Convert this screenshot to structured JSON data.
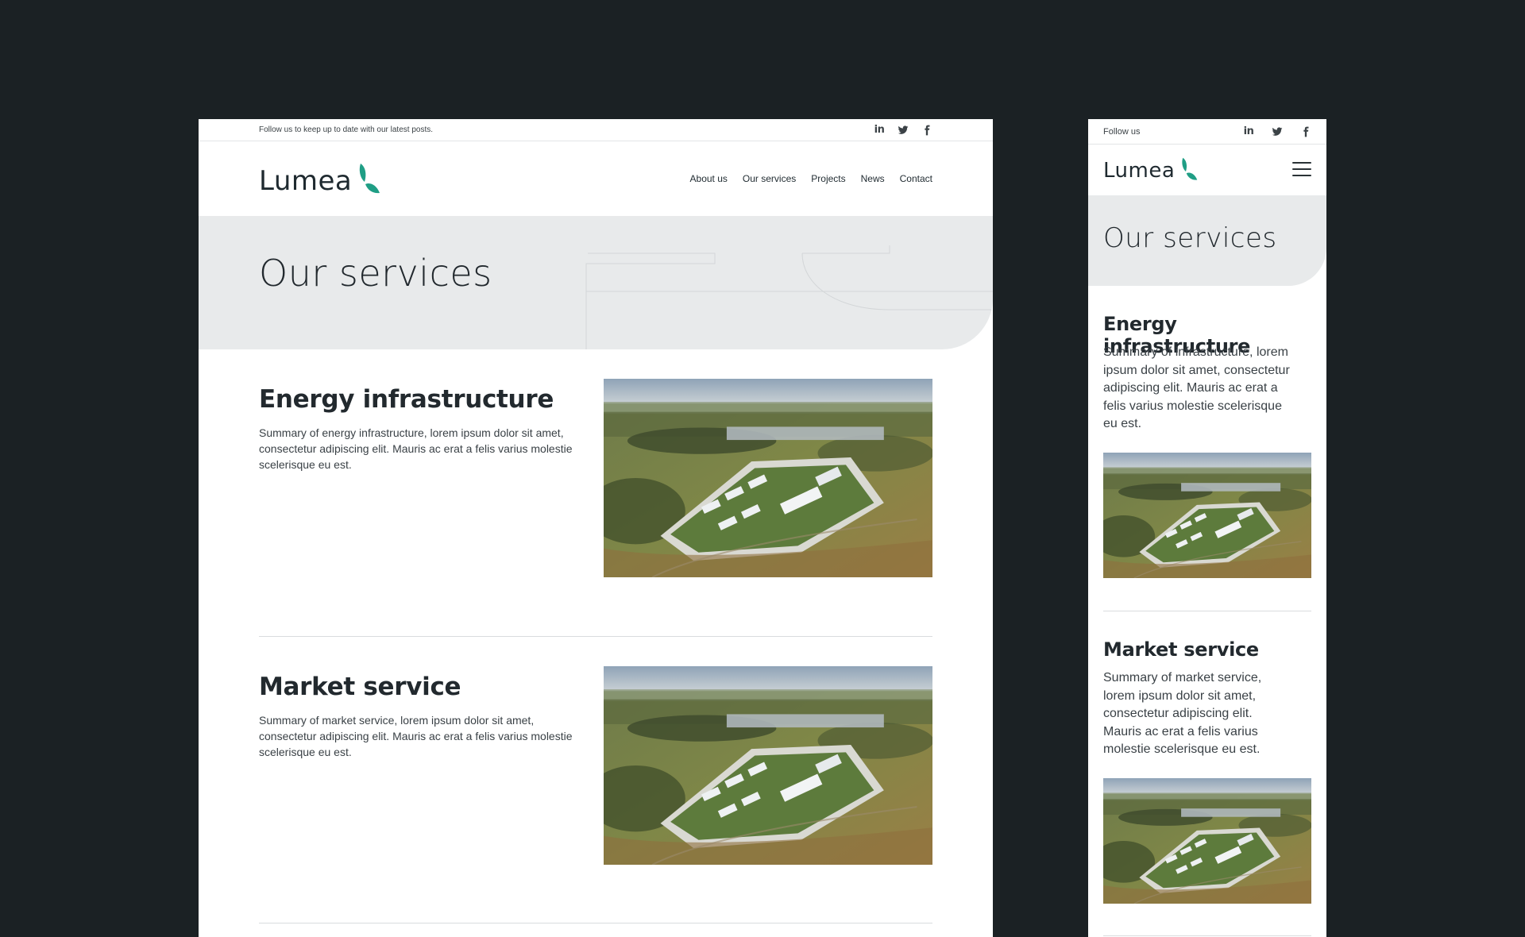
{
  "brand": {
    "name": "Lumea",
    "accent": "#1f9e85",
    "dark": "#1b2124",
    "hero_bg": "#e8eaeb"
  },
  "desktop": {
    "topbar": {
      "text": "Follow us to keep up to date with our latest posts.",
      "socials": [
        "linkedin-icon",
        "twitter-icon",
        "facebook-icon"
      ]
    },
    "nav": [
      "About us",
      "Our services",
      "Projects",
      "News",
      "Contact"
    ],
    "hero": {
      "title": "Our services"
    },
    "services": [
      {
        "title": "Energy infrastructure",
        "summary": "Summary of energy infrastructure, lorem ipsum dolor sit amet, consectetur adipiscing elit. Mauris ac erat a felis varius molestie scelerisque eu est."
      },
      {
        "title": "Market service",
        "summary": "Summary of market service, lorem ipsum dolor sit amet, consectetur adipiscing elit. Mauris ac erat a felis varius molestie scelerisque eu est."
      }
    ]
  },
  "mobile": {
    "topbar": {
      "text": "Follow us",
      "socials": [
        "linkedin-icon",
        "twitter-icon",
        "facebook-icon"
      ]
    },
    "menu_icon": "hamburger-menu-icon",
    "hero": {
      "title": "Our services"
    },
    "services": [
      {
        "title": "Energy infrastructure",
        "summary": "Summary of infrastructure, lorem ipsum dolor sit amet, consectetur adipiscing elit. Mauris ac erat a felis varius molestie scelerisque eu est."
      },
      {
        "title": "Market service",
        "summary": "Summary of market service, lorem ipsum dolor sit amet, consectetur adipiscing elit. Mauris ac erat a felis varius molestie scelerisque eu est."
      }
    ]
  }
}
